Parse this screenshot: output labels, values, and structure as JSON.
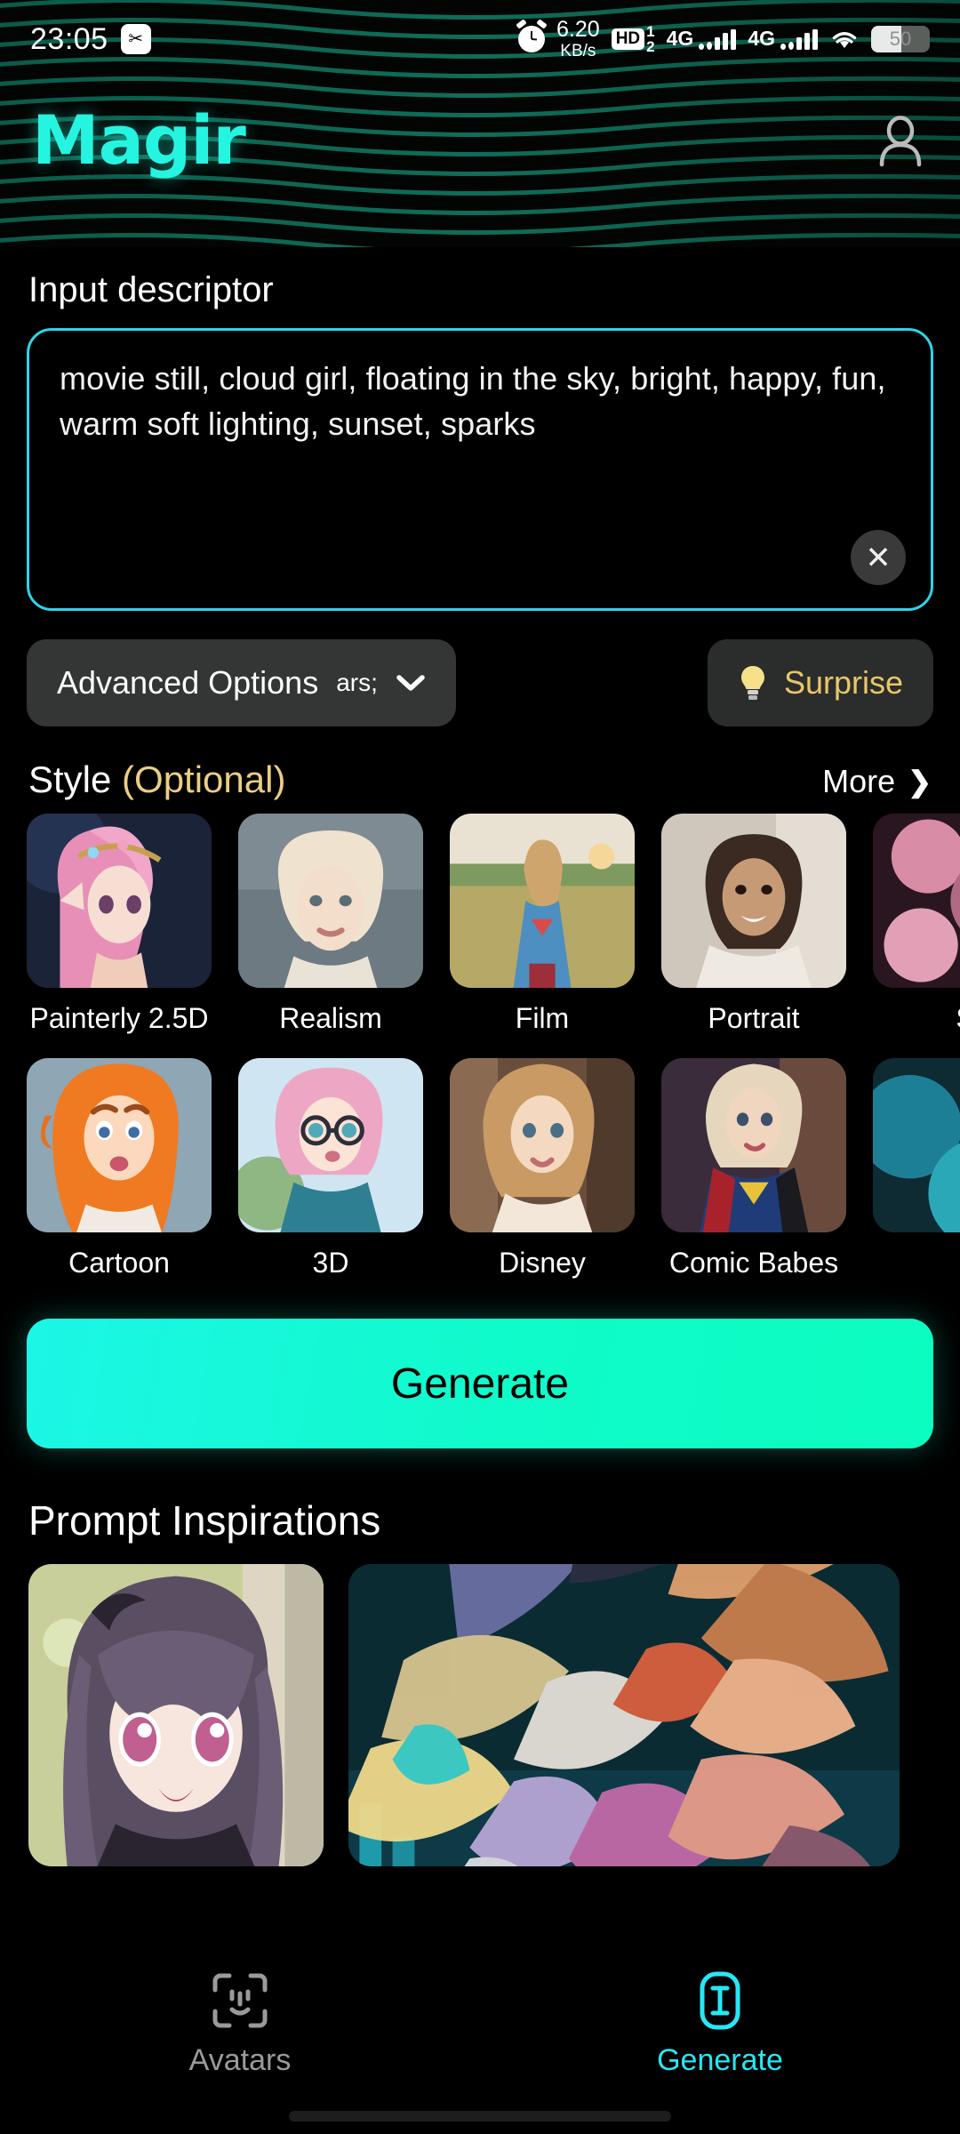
{
  "statusbar": {
    "time": "23:05",
    "screenshot_icon": "scissors-icon",
    "alarm_icon": "alarm-clock-icon",
    "network_speed_value": "6.20",
    "network_speed_unit": "KB/s",
    "hd_badge": "HD",
    "hd_sim_top": "1",
    "hd_sim_bottom": "2",
    "sim1_network": "4G",
    "sim2_network": "4G",
    "wifi_icon": "wifi-icon",
    "battery_level": "50"
  },
  "header": {
    "app_name": "Magir",
    "brand_color": "#25F5E0",
    "profile_icon": "person-icon"
  },
  "prompt": {
    "section_label": "Input descriptor",
    "value": "movie still, cloud girl, floating in the sky,  bright, happy, fun, warm soft lighting, sunset, sparks",
    "placeholder": "Input descriptor",
    "clear_icon": "close-icon",
    "border_color": "#2CD5E8"
  },
  "options": {
    "advanced_label": "Advanced Options",
    "advanced_chevron": "chevron-down-icon",
    "surprise_label": "Surprise",
    "surprise_icon": "lightbulb-icon",
    "surprise_color": "#E8C76A"
  },
  "style": {
    "title": "Style",
    "optional": "(Optional)",
    "more_label": "More",
    "more_icon": "chevron-right-icon",
    "row1": [
      {
        "label": "Painterly 2.5D",
        "thumb": "elf-girl-pink-hair"
      },
      {
        "label": "Realism",
        "thumb": "blonde-woman-portrait"
      },
      {
        "label": "Film",
        "thumb": "woman-in-wheat-field"
      },
      {
        "label": "Portrait",
        "thumb": "smiling-woman-window"
      },
      {
        "label": "S",
        "thumb": "pink-abstract-partial"
      }
    ],
    "row2": [
      {
        "label": "Cartoon",
        "thumb": "redhead-cartoon-girl"
      },
      {
        "label": "3D",
        "thumb": "pink-hair-glasses-3d"
      },
      {
        "label": "Disney",
        "thumb": "disney-style-woman"
      },
      {
        "label": "Comic Babes",
        "thumb": "supergirl-comic"
      },
      {
        "label": "",
        "thumb": "cyan-partial"
      }
    ]
  },
  "generate": {
    "label": "Generate",
    "gradient_from": "#1CF6E6",
    "gradient_to": "#0BFDC0"
  },
  "inspirations": {
    "title": "Prompt Inspirations",
    "cards": [
      {
        "name": "anime-girl-garden"
      },
      {
        "name": "abstract-paint-strokes"
      }
    ]
  },
  "bottomnav": {
    "items": [
      {
        "label": "Avatars",
        "icon": "face-scan-icon",
        "active": false
      },
      {
        "label": "Generate",
        "icon": "text-cursor-icon",
        "active": true
      }
    ],
    "active_color": "#25E8F5",
    "inactive_color": "#9a9a9a"
  }
}
